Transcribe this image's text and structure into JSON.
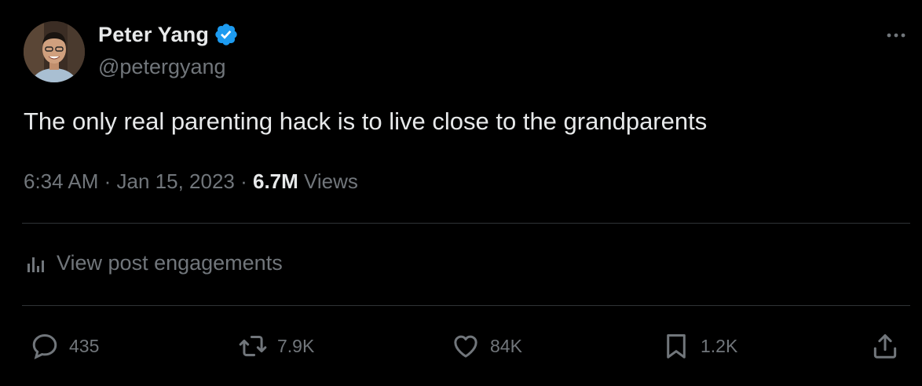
{
  "author": {
    "name": "Peter Yang",
    "handle": "@petergyang",
    "verified_color": "#1d9bf0"
  },
  "post": {
    "text": "The only real parenting hack is to live close to the grandparents",
    "time": "6:34 AM",
    "date": "Jan 15, 2023",
    "separator": " · ",
    "views_count": "6.7M",
    "views_label": " Views"
  },
  "engagements_label": "View post engagements",
  "actions": {
    "replies": "435",
    "reposts": "7.9K",
    "likes": "84K",
    "bookmarks": "1.2K"
  },
  "icons": {
    "more": "more-horizontal-icon",
    "reply": "reply-bubble-icon",
    "retweet": "retweet-icon",
    "like": "heart-icon",
    "bookmark": "bookmark-icon",
    "share": "share-icon",
    "analytics": "analytics-bars-icon"
  }
}
